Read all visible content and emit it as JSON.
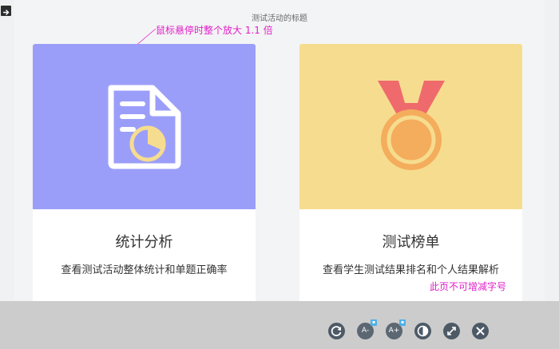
{
  "page": {
    "title": "测试活动的标题"
  },
  "annotations": {
    "hover_note": "鼠标悬停时整个放大 1.1 倍",
    "font_note": "此页不可增减字号",
    "color": "#e020c8"
  },
  "cards": [
    {
      "title": "统计分析",
      "description": "查看测试活动整体统计和单题正确率",
      "icon": "report-chart-icon",
      "bg_color": "#9b9ef9"
    },
    {
      "title": "测试榜单",
      "description": "查看学生测试结果排名和个人结果解析",
      "icon": "medal-icon",
      "bg_color": "#f6dc8f"
    }
  ],
  "toolbar": {
    "buttons": [
      {
        "name": "refresh-icon"
      },
      {
        "name": "font-decrease-icon",
        "label": "A-"
      },
      {
        "name": "font-increase-icon",
        "label": "A+"
      },
      {
        "name": "contrast-icon"
      },
      {
        "name": "fullscreen-icon"
      },
      {
        "name": "close-icon"
      }
    ]
  }
}
